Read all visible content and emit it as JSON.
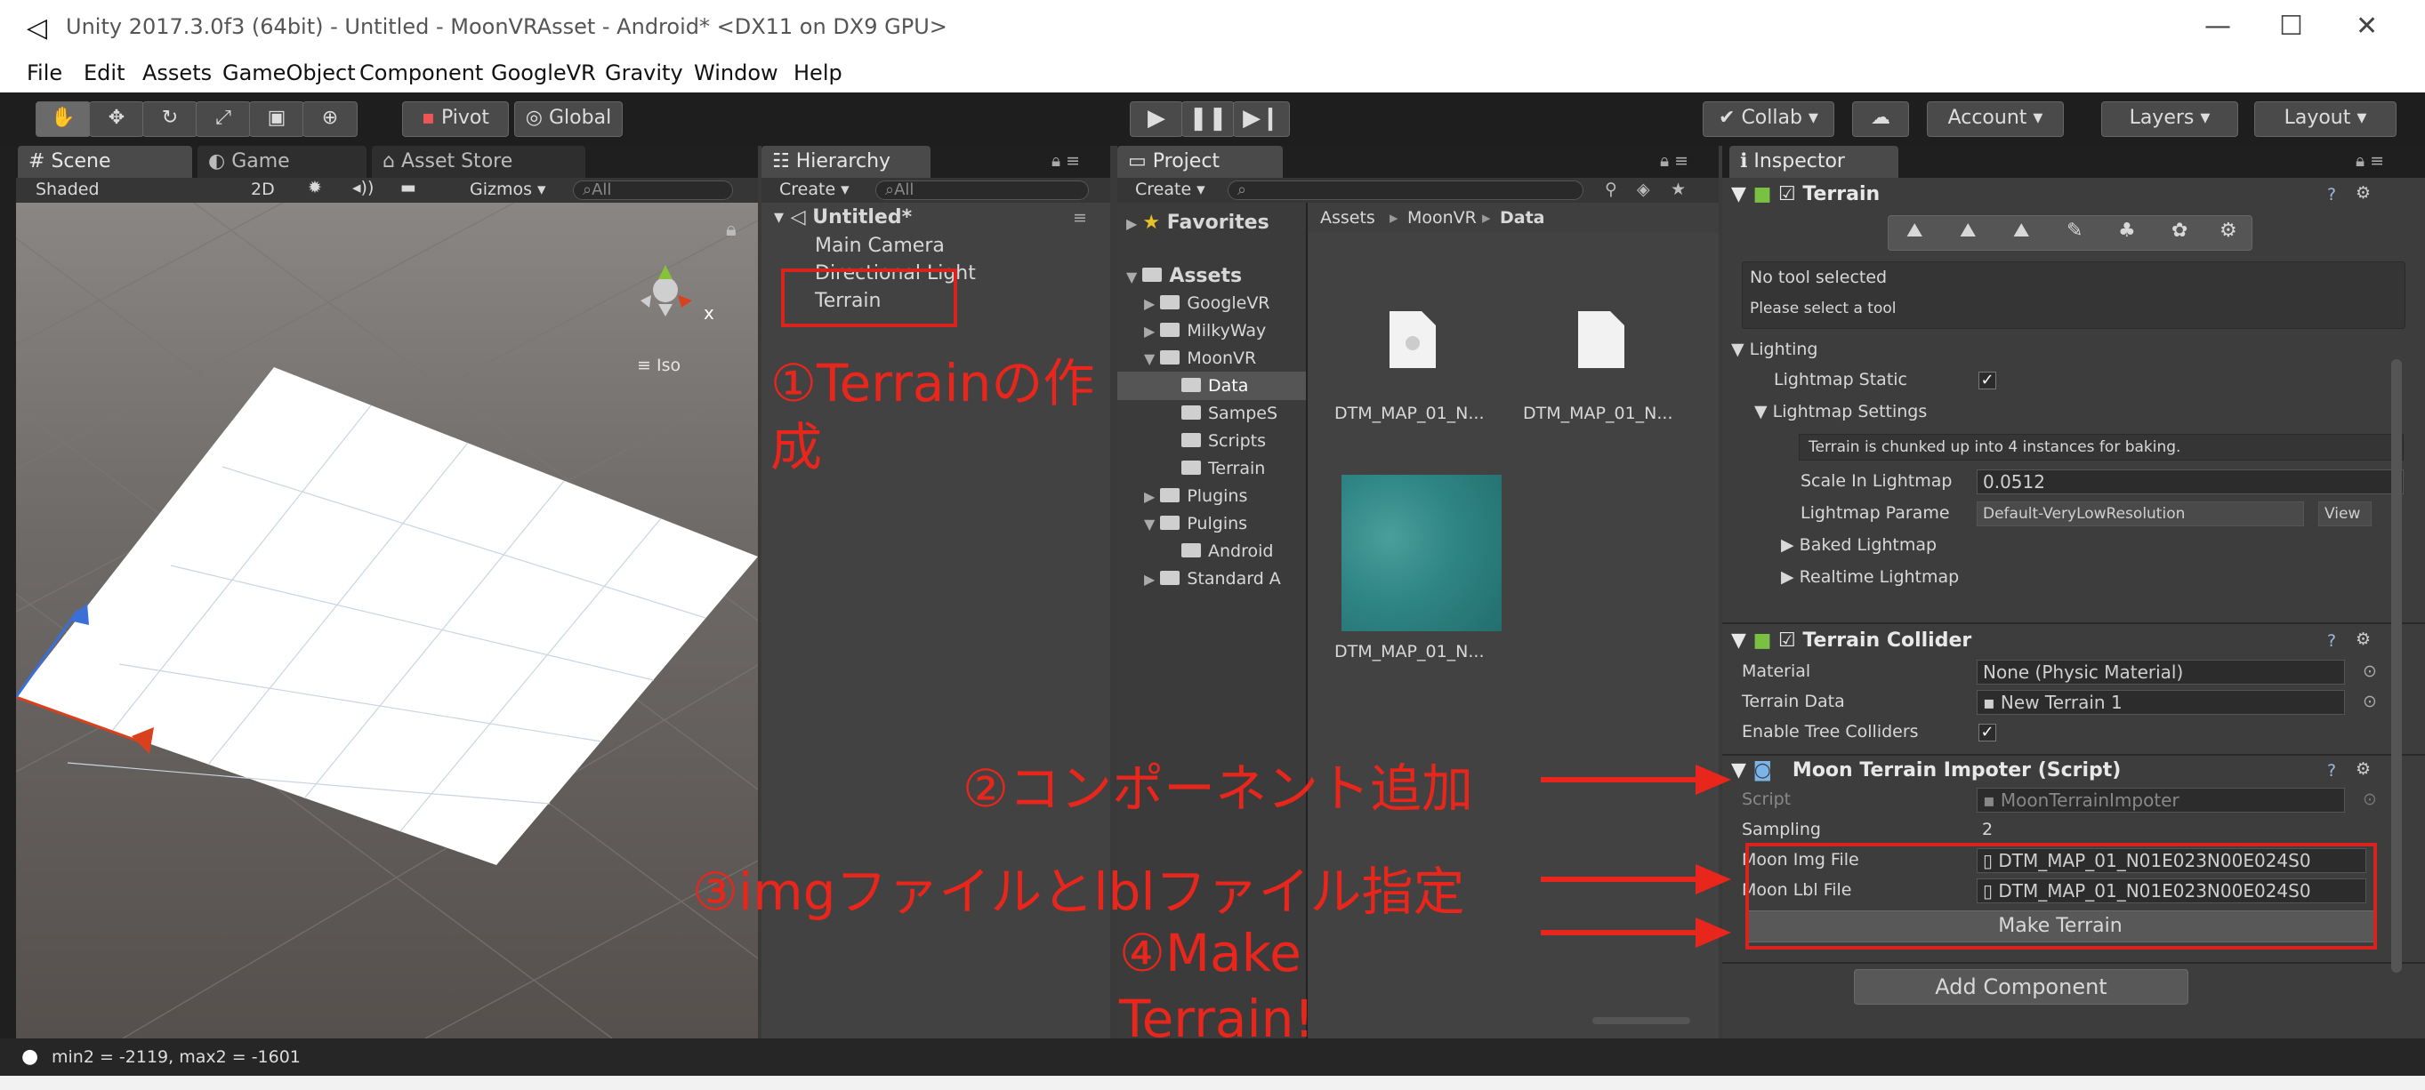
{
  "window": {
    "title": "Unity 2017.3.0f3 (64bit) - Untitled - MoonVRAsset - Android* <DX11 on DX9 GPU>"
  },
  "menu": [
    "File",
    "Edit",
    "Assets",
    "GameObject",
    "Component",
    "GoogleVR",
    "Gravity",
    "Window",
    "Help"
  ],
  "toolbar": {
    "pivot": "Pivot",
    "global": "Global",
    "collab": "Collab",
    "account": "Account",
    "layers": "Layers",
    "layout": "Layout"
  },
  "scene": {
    "tabs": [
      "Scene",
      "Game",
      "Asset Store"
    ],
    "shading": "Shaded",
    "mode2d": "2D",
    "gizmos": "Gizmos",
    "search": "All",
    "projection": "Iso"
  },
  "hierarchy": {
    "tab": "Hierarchy",
    "create": "Create",
    "search": "All",
    "root": "Untitled*",
    "items": [
      "Main Camera",
      "Directional Light",
      "Terrain"
    ]
  },
  "project": {
    "tab": "Project",
    "create": "Create",
    "favorites": "Favorites",
    "tree": [
      "Assets",
      "GoogleVR",
      "MilkyWay",
      "MoonVR",
      "Data",
      "SampeS",
      "Scripts",
      "Terrain",
      "Plugins",
      "Pulgins",
      "Android",
      "Standard A"
    ],
    "breadcrumb": [
      "Assets",
      "MoonVR",
      "Data"
    ],
    "files": [
      "DTM_MAP_01_N...",
      "DTM_MAP_01_N...",
      "DTM_MAP_01_N..."
    ]
  },
  "inspector": {
    "tab": "Inspector",
    "terrain": {
      "title": "Terrain",
      "notool": "No tool selected",
      "notool_hint": "Please select a tool",
      "lighting": "Lighting",
      "lightmap_static": "Lightmap Static",
      "lightmap_settings": "Lightmap Settings",
      "chunk_info": "Terrain is chunked up into 4 instances for baking.",
      "scale_label": "Scale In Lightmap",
      "scale_value": "0.0512",
      "param_label": "Lightmap Parame",
      "param_value": "Default-VeryLowResolution",
      "view": "View",
      "baked": "Baked Lightmap",
      "realtime": "Realtime Lightmap"
    },
    "collider": {
      "title": "Terrain Collider",
      "material_label": "Material",
      "material_value": "None (Physic Material)",
      "data_label": "Terrain Data",
      "data_value": "New Terrain 1",
      "trees_label": "Enable Tree Colliders"
    },
    "script": {
      "title": "Moon Terrain Impoter (Script)",
      "script_label": "Script",
      "script_value": "MoonTerrainImpoter",
      "sampling_label": "Sampling",
      "sampling_value": "2",
      "img_label": "Moon Img File",
      "img_value": "DTM_MAP_01_N01E023N00E024S0",
      "lbl_label": "Moon Lbl File",
      "lbl_value": "DTM_MAP_01_N01E023N00E024S0",
      "make": "Make Terrain"
    },
    "add_component": "Add Component"
  },
  "status": "min2 = -2119, max2 = -1601",
  "annotations": {
    "a1_line1": "①Terrainの作",
    "a1_line2": "成",
    "a2": "②コンポーネント追加",
    "a3": "③imgファイルとlblファイル指定",
    "a4_line1": "④Make",
    "a4_line2": "Terrain!"
  },
  "colors": {
    "accent_red": "#e8261c",
    "selection": "#3e5f8a",
    "panel": "#424242"
  }
}
